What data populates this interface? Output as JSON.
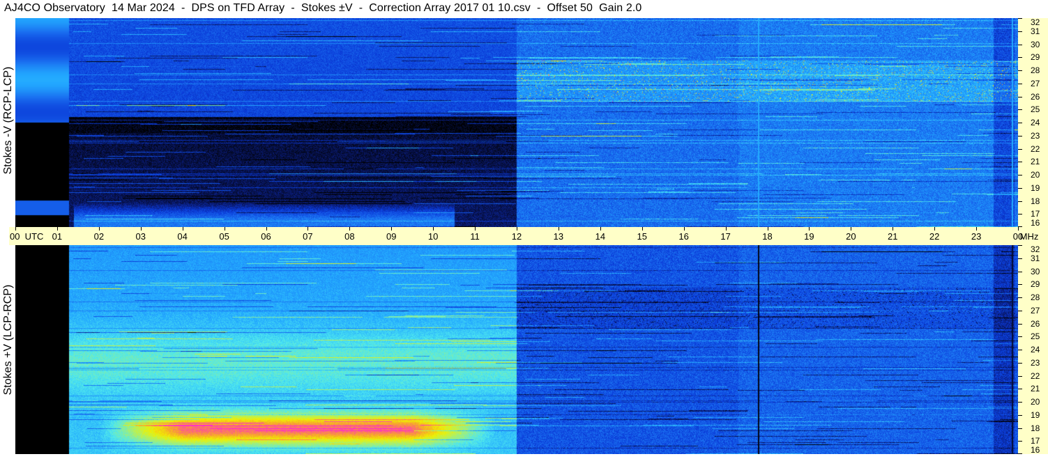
{
  "title": "AJ4CO Observatory  14 Mar 2024  -  DPS on TFD Array  -  Stokes ±V  -  Correction Array 2017 01 10.csv  -  Offset 50  Gain 2.0",
  "colors": {
    "axis_background": "#ffffc8",
    "colormap": [
      "#000000",
      "#0a1a70",
      "#0a3ad8",
      "#1a6ef0",
      "#22a8ff",
      "#4ee8f0",
      "#a8f070",
      "#f0f000",
      "#f8a030",
      "#ff2ccc"
    ]
  },
  "chart_data": [
    {
      "type": "heatmap",
      "panel": "top",
      "ylabel": "Stokes -V (RCP-LCP)",
      "x_ticks": [
        "00  UTC",
        "01",
        "02",
        "03",
        "04",
        "05",
        "06",
        "07",
        "08",
        "09",
        "10",
        "11",
        "12",
        "13",
        "14",
        "15",
        "16",
        "17",
        "18",
        "19",
        "20",
        "21",
        "22",
        "23",
        "00"
      ],
      "x_range_hours": [
        0,
        24
      ],
      "xunit": "MHz",
      "y_ticks": [
        "16",
        "17",
        "18",
        "19",
        "20",
        "21",
        "22",
        "23",
        "24",
        "25",
        "26",
        "27",
        "28",
        "29",
        "30",
        "31",
        "32"
      ],
      "ylim_mhz": [
        16,
        32
      ]
    },
    {
      "type": "heatmap",
      "panel": "bottom",
      "ylabel": "Stokes +V (LCP-RCP)",
      "x_ticks": [
        "00  UTC",
        "01",
        "02",
        "03",
        "04",
        "05",
        "06",
        "07",
        "08",
        "09",
        "10",
        "11",
        "12",
        "13",
        "14",
        "15",
        "16",
        "17",
        "18",
        "19",
        "20",
        "21",
        "22",
        "23",
        "00"
      ],
      "x_range_hours": [
        0,
        24
      ],
      "xunit": "MHz",
      "y_ticks": [
        "16",
        "17",
        "18",
        "19",
        "20",
        "21",
        "22",
        "23",
        "24",
        "25",
        "26",
        "27",
        "28",
        "29",
        "30",
        "31",
        "32"
      ],
      "ylim_mhz": [
        16,
        32
      ]
    }
  ]
}
